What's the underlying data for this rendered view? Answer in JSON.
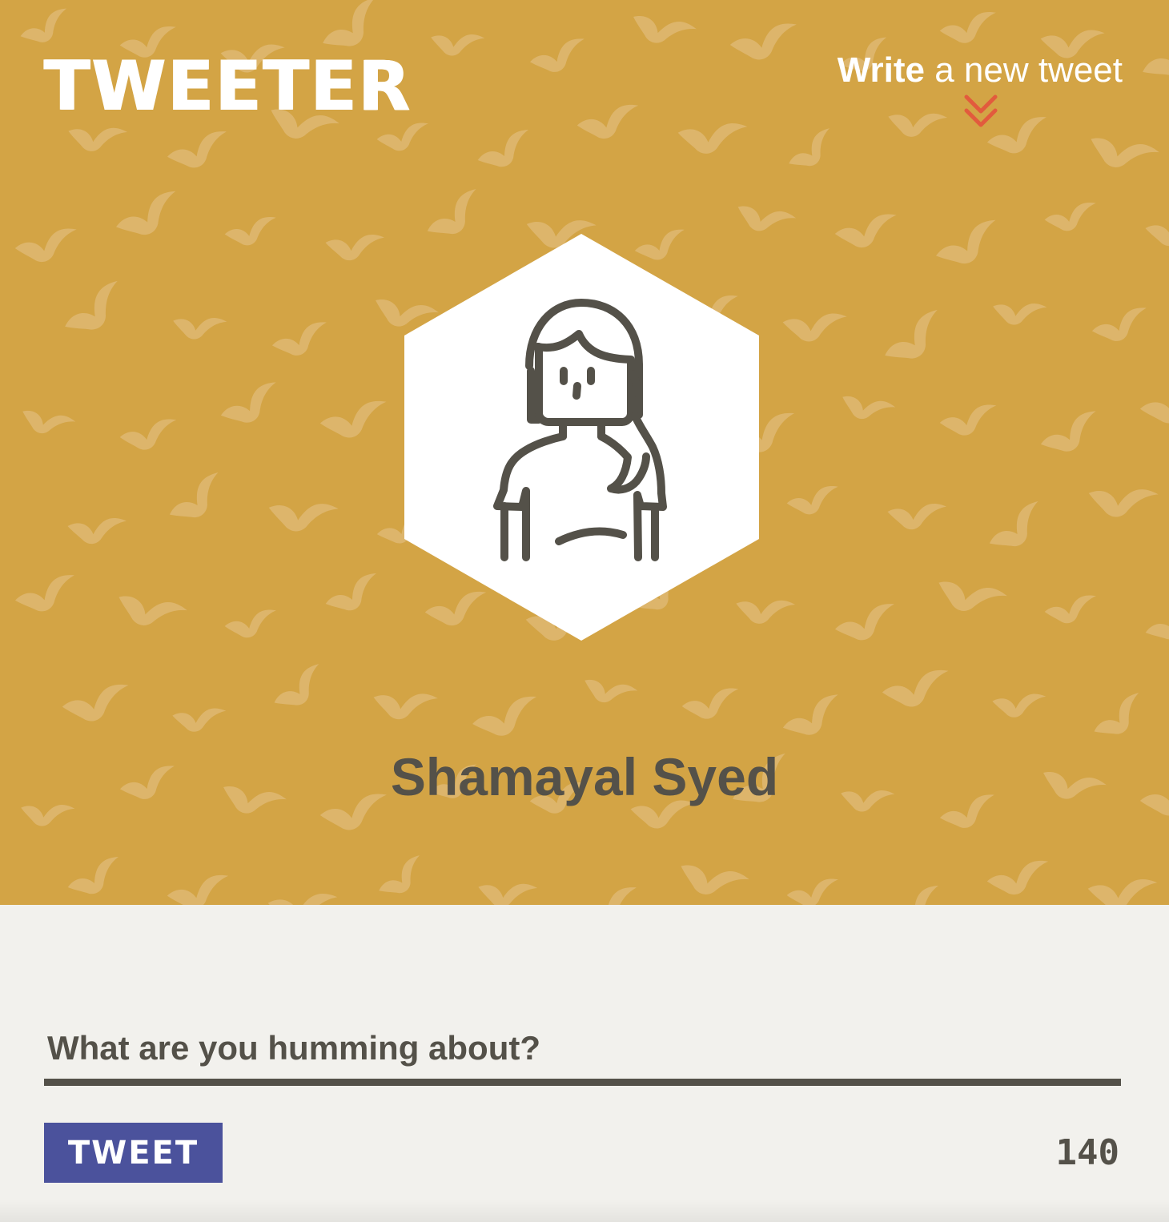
{
  "app": {
    "logo": "TWEETER"
  },
  "header": {
    "compose_strong": "Write",
    "compose_rest": " a new tweet",
    "compose_icon": "chevron-double-down-icon",
    "avatar_icon": "woman-avatar-icon"
  },
  "profile": {
    "name": "Shamayal Syed"
  },
  "composer": {
    "placeholder": "What are you humming about?",
    "value": "",
    "button_label": "TWEET",
    "character_counter": "140"
  },
  "colors": {
    "header_background": "#d3a445",
    "page_background": "#f2f1ed",
    "text": "#545149",
    "button": "#4b529c",
    "accent": "#e25b3d",
    "white": "#ffffff"
  }
}
